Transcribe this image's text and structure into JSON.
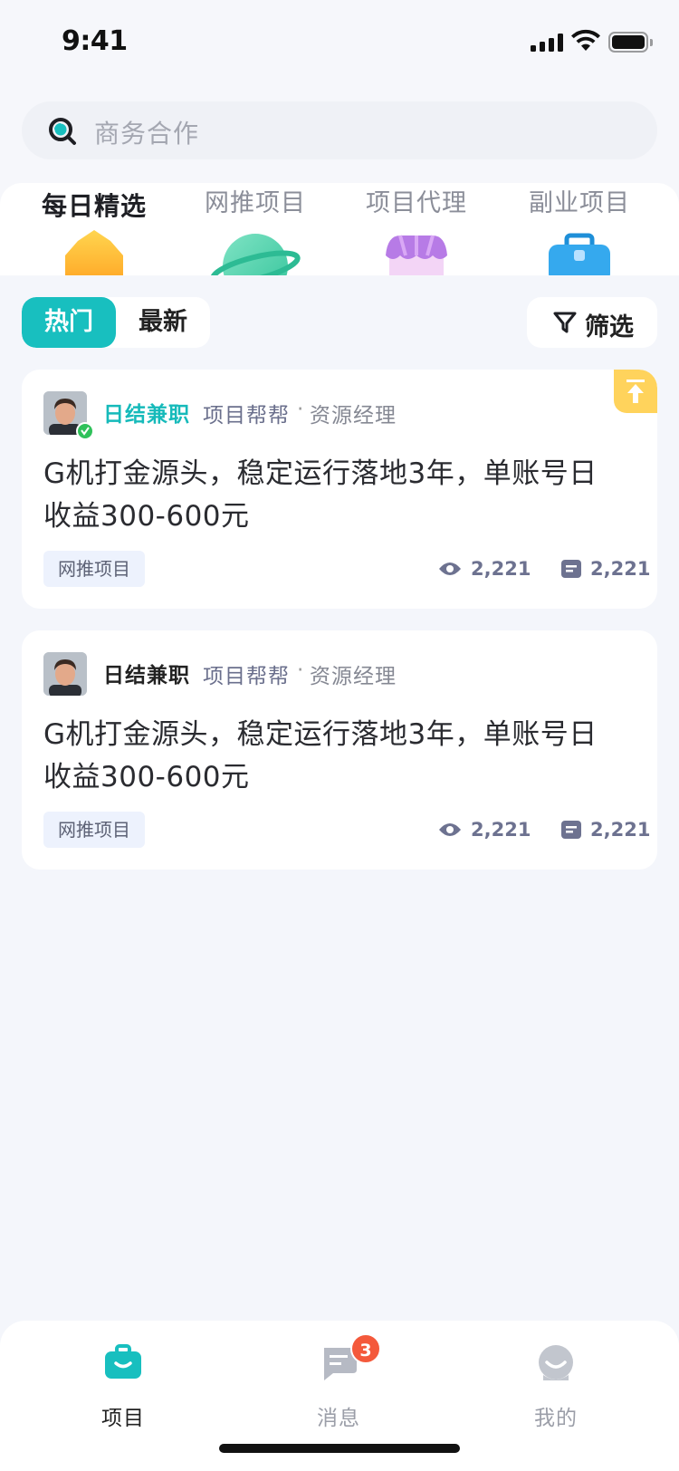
{
  "status_bar": {
    "time": "9:41"
  },
  "search": {
    "placeholder": "商务合作"
  },
  "categories": [
    {
      "label": "每日精选",
      "icon": "crown-icon"
    },
    {
      "label": "网推项目",
      "icon": "planet-icon"
    },
    {
      "label": "项目代理",
      "icon": "shop-icon"
    },
    {
      "label": "副业项目",
      "icon": "briefcase-icon"
    }
  ],
  "sort": {
    "hot": "热门",
    "latest": "最新"
  },
  "filter": {
    "label": "筛选"
  },
  "posts": [
    {
      "author": "日结兼职",
      "org": "项目帮帮",
      "separator": "·",
      "role": "资源经理",
      "title": "G机打金源头，稳定运行落地3年，单账号日收益300-600元",
      "tag": "网推项目",
      "views": "2,221",
      "comments": "2,221",
      "pinned": true,
      "verified": true
    },
    {
      "author": "日结兼职",
      "org": "项目帮帮",
      "separator": "·",
      "role": "资源经理",
      "title": "G机打金源头，稳定运行落地3年，单账号日收益300-600元",
      "tag": "网推项目",
      "views": "2,221",
      "comments": "2,221",
      "pinned": false,
      "verified": false
    }
  ],
  "bottom_nav": {
    "projects": "项目",
    "messages": "消息",
    "messages_badge": "3",
    "me": "我的"
  },
  "colors": {
    "accent": "#18BFBF",
    "badge": "#F4593B",
    "pin": "#FFD35C"
  }
}
